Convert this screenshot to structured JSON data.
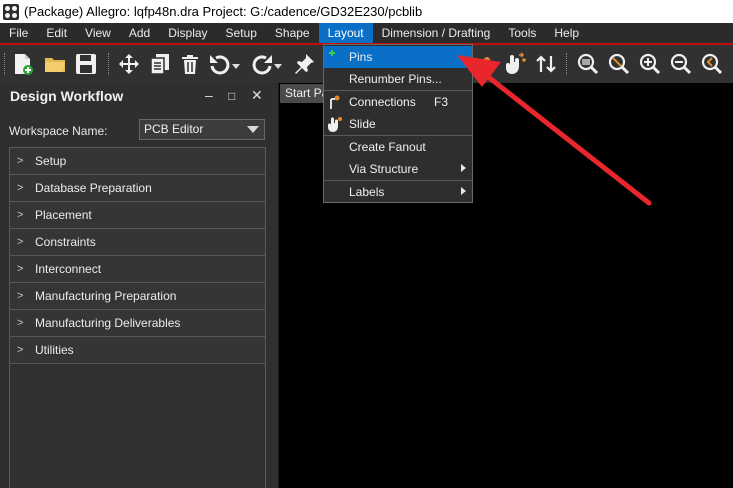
{
  "window": {
    "title": "(Package) Allegro: lqfp48n.dra  Project: G:/cadence/GD32E230/pcblib"
  },
  "menubar": [
    {
      "label": "File"
    },
    {
      "label": "Edit"
    },
    {
      "label": "View"
    },
    {
      "label": "Add"
    },
    {
      "label": "Display"
    },
    {
      "label": "Setup"
    },
    {
      "label": "Shape"
    },
    {
      "label": "Layout",
      "active": true
    },
    {
      "label": "Dimension / Drafting"
    },
    {
      "label": "Tools"
    },
    {
      "label": "Help"
    }
  ],
  "layout_menu": {
    "items": [
      {
        "label": "Pins",
        "icon": "add-pin-icon",
        "selected": true
      },
      {
        "label": "Renumber Pins..."
      },
      {
        "label": "Connections",
        "shortcut": "F3",
        "icon": "connect-icon"
      },
      {
        "label": "Slide",
        "icon": "slide-hand-icon"
      },
      {
        "label": "Create Fanout"
      },
      {
        "label": "Via Structure",
        "submenu": true
      },
      {
        "label": "Labels",
        "submenu": true
      }
    ]
  },
  "panel": {
    "title": "Design Workflow",
    "controls": [
      "–",
      "□",
      "✕"
    ],
    "workspace_label": "Workspace Name:",
    "workspace_value": "PCB Editor",
    "steps": [
      "Setup",
      "Database Preparation",
      "Placement",
      "Constraints",
      "Interconnect",
      "Manufacturing Preparation",
      "Manufacturing Deliverables",
      "Utilities"
    ]
  },
  "canvas": {
    "tab_label": "Start Page"
  },
  "colors": {
    "accent": "#0a6fc7",
    "annotation_arrow": "#e8262c",
    "menubar_underline": "#c00d0d"
  }
}
